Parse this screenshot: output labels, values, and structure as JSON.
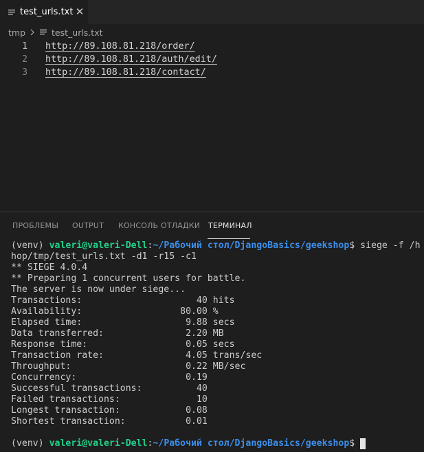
{
  "editor_tab": {
    "label": "test_urls.txt",
    "close_glyph": "✕"
  },
  "breadcrumb": {
    "folder": "tmp",
    "file": "test_urls.txt"
  },
  "code_lines": [
    {
      "num": "1",
      "text": "http://89.108.81.218/order/"
    },
    {
      "num": "2",
      "text": "http://89.108.81.218/auth/edit/"
    },
    {
      "num": "3",
      "text": "http://89.108.81.218/contact/"
    }
  ],
  "panel_tabs": [
    "ПРОБЛЕМЫ",
    "OUTPUT",
    "КОНСОЛЬ ОТЛАДКИ",
    "ТЕРМИНАЛ"
  ],
  "terminal": {
    "prompt": {
      "venv": "(venv) ",
      "user": "valeri@valeri-Dell",
      "colon": ":",
      "path": "~/Рабочий стол/DjangoBasics/geekshop",
      "dollar": "$ "
    },
    "command_part1": "siege -f /h",
    "command_part2": "hop/tmp/test_urls.txt -d1 -r15 -c1",
    "output": [
      "** SIEGE 4.0.4",
      "** Preparing 1 concurrent users for battle.",
      "The server is now under siege...",
      "Transactions:                     40 hits",
      "Availability:                  80.00 %",
      "Elapsed time:                   9.88 secs",
      "Data transferred:               2.20 MB",
      "Response time:                  0.05 secs",
      "Transaction rate:               4.05 trans/sec",
      "Throughput:                     0.22 MB/sec",
      "Concurrency:                    0.19",
      "Successful transactions:          40",
      "Failed transactions:              10",
      "Longest transaction:            0.08",
      "Shortest transaction:           0.01"
    ]
  },
  "icons": {
    "file": "file-lines-icon",
    "chevron": "chevron-right-icon",
    "close": "close-icon"
  },
  "colors": {
    "editor_bg": "#1e1e1e",
    "tab_bar_bg": "#252526",
    "prompt_user": "#23d18b",
    "prompt_path": "#3b8eea"
  }
}
